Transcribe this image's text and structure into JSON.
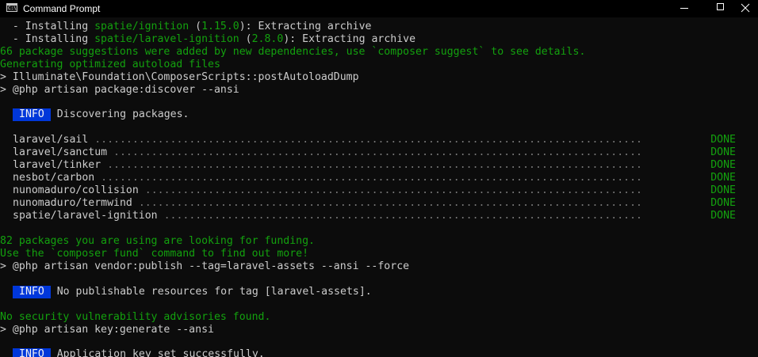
{
  "window": {
    "title": "Command Prompt",
    "icon_text": "C:\\",
    "controls": {
      "minimize": "minimize-icon",
      "maximize": "maximize-icon",
      "close": "close-icon"
    }
  },
  "colors": {
    "background": "#0c0c0c",
    "text": "#cccccc",
    "green": "#13a10e",
    "info_badge_bg": "#0037da"
  },
  "console": {
    "install_lines": [
      {
        "prefix": "  - Installing ",
        "package": "spatie/ignition",
        "open": " (",
        "version": "1.15.0",
        "suffix": "): Extracting archive"
      },
      {
        "prefix": "  - Installing ",
        "package": "spatie/laravel-ignition",
        "open": " (",
        "version": "2.8.0",
        "suffix": "): Extracting archive"
      }
    ],
    "suggestions_line": "66 package suggestions were added by new dependencies, use `composer suggest` to see details.",
    "autoload_line": "Generating optimized autoload files",
    "post_autoload_line": "> Illuminate\\Foundation\\ComposerScripts::postAutoloadDump",
    "package_discover_line": "> @php artisan package:discover --ansi",
    "info_badge": "INFO",
    "discovering_text": "Discovering packages.",
    "packages": [
      {
        "name": "laravel/sail",
        "status": "DONE"
      },
      {
        "name": "laravel/sanctum",
        "status": "DONE"
      },
      {
        "name": "laravel/tinker",
        "status": "DONE"
      },
      {
        "name": "nesbot/carbon",
        "status": "DONE"
      },
      {
        "name": "nunomaduro/collision",
        "status": "DONE"
      },
      {
        "name": "nunomaduro/termwind",
        "status": "DONE"
      },
      {
        "name": "spatie/laravel-ignition",
        "status": "DONE"
      }
    ],
    "funding_line_1": "82 packages you are using are looking for funding.",
    "funding_line_2": "Use the `composer fund` command to find out more!",
    "vendor_publish_line": "> @php artisan vendor:publish --tag=laravel-assets --ansi --force",
    "no_publishable_text": "No publishable resources for tag [laravel-assets].",
    "security_line": "No security vulnerability advisories found.",
    "key_generate_line": "> @php artisan key:generate --ansi",
    "app_key_text": "Application key set successfully."
  }
}
